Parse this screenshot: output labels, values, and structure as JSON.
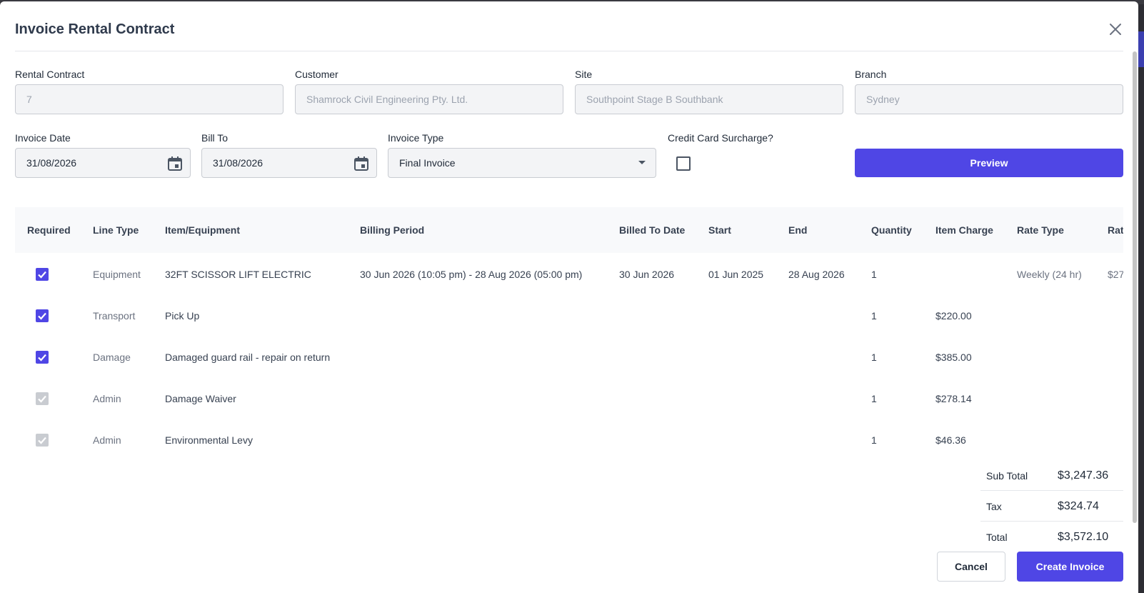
{
  "modal": {
    "title": "Invoice Rental Contract",
    "close_icon": "close-icon"
  },
  "fields": {
    "rental_contract": {
      "label": "Rental Contract",
      "value": "7"
    },
    "customer": {
      "label": "Customer",
      "value": "Shamrock Civil Engineering Pty. Ltd."
    },
    "site": {
      "label": "Site",
      "value": "Southpoint Stage B Southbank"
    },
    "branch": {
      "label": "Branch",
      "value": "Sydney"
    },
    "invoice_date": {
      "label": "Invoice Date",
      "value": "31/08/2026",
      "icon": "calendar-icon"
    },
    "bill_to": {
      "label": "Bill To",
      "value": "31/08/2026",
      "icon": "calendar-icon"
    },
    "invoice_type": {
      "label": "Invoice Type",
      "value": "Final Invoice"
    },
    "credit_card_surcharge": {
      "label": "Credit Card Surcharge?",
      "checked": false
    }
  },
  "buttons": {
    "preview": "Preview",
    "cancel": "Cancel",
    "create_invoice": "Create Invoice"
  },
  "table": {
    "columns": [
      "Required",
      "Line Type",
      "Item/Equipment",
      "Billing Period",
      "Billed To Date",
      "Start",
      "End",
      "Quantity",
      "Item Charge",
      "Rate Type",
      "Rat"
    ],
    "rows": [
      {
        "required": true,
        "enabled": true,
        "line_type": "Equipment",
        "item": "32FT SCISSOR LIFT ELECTRIC",
        "billing_period": "30 Jun 2026 (10:05 pm) - 28 Aug 2026 (05:00 pm)",
        "billed_to_date": "30 Jun 2026",
        "start": "01 Jun 2025",
        "end": "28 Aug 2026",
        "quantity": "1",
        "item_charge": "",
        "rate_type": "Weekly (24 hr)",
        "rate": "$27"
      },
      {
        "required": true,
        "enabled": true,
        "line_type": "Transport",
        "item": "Pick Up",
        "billing_period": "",
        "billed_to_date": "",
        "start": "",
        "end": "",
        "quantity": "1",
        "item_charge": "$220.00",
        "rate_type": "",
        "rate": ""
      },
      {
        "required": true,
        "enabled": true,
        "line_type": "Damage",
        "item": "Damaged guard rail - repair on return",
        "billing_period": "",
        "billed_to_date": "",
        "start": "",
        "end": "",
        "quantity": "1",
        "item_charge": "$385.00",
        "rate_type": "",
        "rate": ""
      },
      {
        "required": true,
        "enabled": false,
        "line_type": "Admin",
        "item": "Damage Waiver",
        "billing_period": "",
        "billed_to_date": "",
        "start": "",
        "end": "",
        "quantity": "1",
        "item_charge": "$278.14",
        "rate_type": "",
        "rate": ""
      },
      {
        "required": true,
        "enabled": false,
        "line_type": "Admin",
        "item": "Environmental Levy",
        "billing_period": "",
        "billed_to_date": "",
        "start": "",
        "end": "",
        "quantity": "1",
        "item_charge": "$46.36",
        "rate_type": "",
        "rate": ""
      }
    ]
  },
  "totals": {
    "sub_total": {
      "label": "Sub Total",
      "value": "$3,247.36"
    },
    "tax": {
      "label": "Tax",
      "value": "$324.74"
    },
    "total": {
      "label": "Total",
      "value": "$3,572.10"
    }
  },
  "colors": {
    "accent": "#4f46e5",
    "disabled_check": "#c9ccd1"
  }
}
